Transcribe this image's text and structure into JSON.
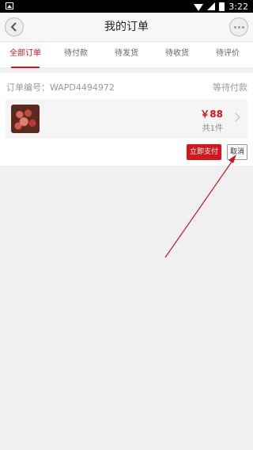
{
  "status_bar": {
    "time": "3:22"
  },
  "header": {
    "title": "我的订单",
    "back_icon": "back-arrow-icon",
    "more_icon": "more-dots-icon"
  },
  "tabs": [
    {
      "label": "全部订单",
      "active": true
    },
    {
      "label": "待付款",
      "active": false
    },
    {
      "label": "待发货",
      "active": false
    },
    {
      "label": "待收货",
      "active": false
    },
    {
      "label": "待评价",
      "active": false
    }
  ],
  "order": {
    "number_label": "订单编号：WAPD4494972",
    "status": "等待付款",
    "item": {
      "price": "￥88",
      "quantity": "共1件"
    },
    "pay_label": "立即支付",
    "cancel_label": "取消"
  },
  "colors": {
    "accent": "#d4161f",
    "annotation_arrow": "#c8151e"
  }
}
